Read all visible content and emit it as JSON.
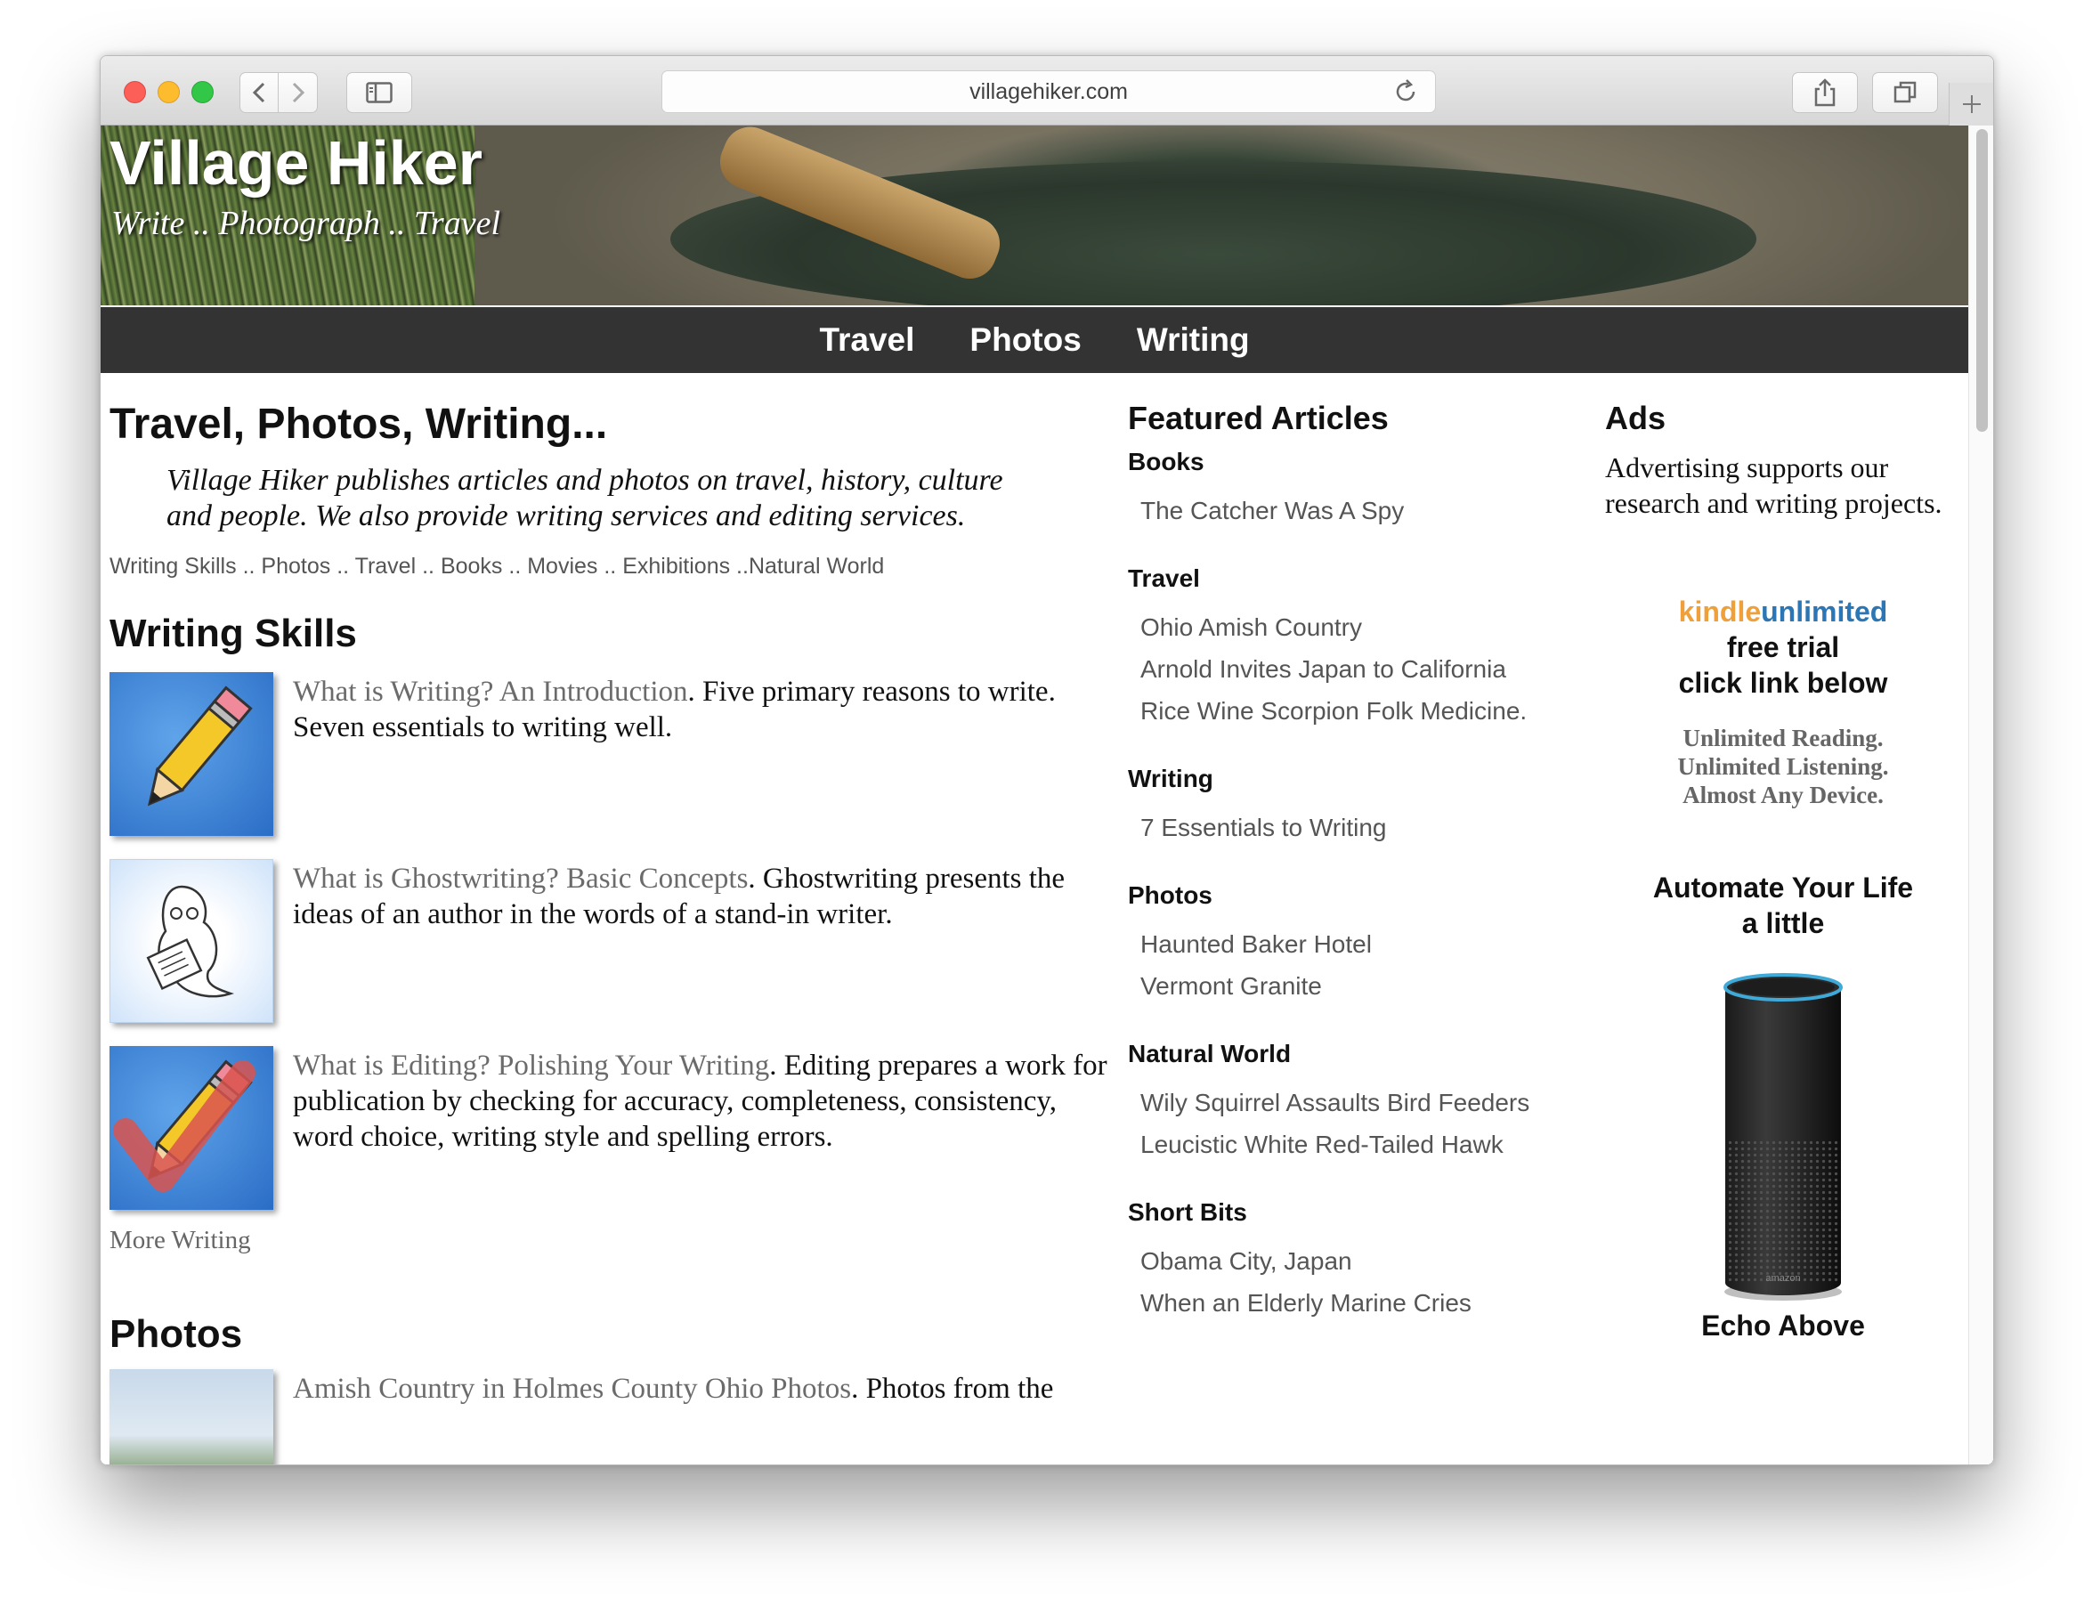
{
  "browser": {
    "url": "villagehiker.com"
  },
  "site": {
    "title": "Village Hiker",
    "tagline": "Write .. Photograph .. Travel"
  },
  "nav": {
    "items": [
      "Travel",
      "Photos",
      "Writing"
    ]
  },
  "main": {
    "heading": "Travel, Photos, Writing...",
    "intro": "Village Hiker publishes articles and photos on travel, history, culture and people. We also provide writing services and editing services.",
    "quicklinks": {
      "writing_skills": "Writing Skills",
      "photos": "Photos",
      "travel": "Travel",
      "books": "Books",
      "movies": "Movies",
      "exhibitions": "Exhibitions",
      "natural_world": "Natural World",
      "sep": " .. ",
      "sep_tight": " .."
    },
    "writing_section": {
      "heading": "Writing Skills",
      "articles": [
        {
          "link": "What is Writing? An Introduction",
          "desc": ". Five primary reasons to write. Seven essentials to writing well.",
          "icon": "pencil-icon"
        },
        {
          "link": "What is Ghostwriting? Basic Concepts",
          "desc": ". Ghostwriting presents the ideas of an author in the words of a stand-in writer.",
          "icon": "ghost-writer-icon"
        },
        {
          "link": "What is Editing? Polishing Your Writing",
          "desc": ". Editing prepares a work for publication by checking for accuracy, completeness, consistency, word choice, writing style and spelling errors.",
          "icon": "pencil-checkmark-icon"
        }
      ],
      "more": "More Writing"
    },
    "photos_section": {
      "heading": "Photos",
      "article": {
        "link": "Amish Country in Holmes County Ohio Photos",
        "desc": ". Photos from the"
      }
    }
  },
  "featured": {
    "heading": "Featured Articles",
    "categories": [
      {
        "name": "Books",
        "items": [
          "The Catcher Was A Spy"
        ]
      },
      {
        "name": "Travel",
        "items": [
          "Ohio Amish Country",
          "Arnold Invites Japan to California",
          "Rice Wine Scorpion Folk Medicine."
        ]
      },
      {
        "name": "Writing",
        "items": [
          "7 Essentials to Writing"
        ]
      },
      {
        "name": "Photos",
        "items": [
          "Haunted Baker Hotel",
          "Vermont Granite"
        ]
      },
      {
        "name": "Natural World",
        "items": [
          "Wily Squirrel Assaults Bird Feeders",
          "Leucistic White Red-Tailed Hawk"
        ]
      },
      {
        "name": "Short Bits",
        "items": [
          "Obama City, Japan",
          "When an Elderly Marine Cries"
        ]
      }
    ]
  },
  "ads": {
    "heading": "Ads",
    "text": "Advertising supports our research and writing projects.",
    "kindle": {
      "brand_1": "kindle",
      "brand_2": "unlimited",
      "line_1": "free trial",
      "line_2": "click link below",
      "sub_1": "Unlimited Reading.",
      "sub_2": "Unlimited Listening.",
      "sub_3": "Almost Any Device."
    },
    "automate": {
      "line_1": "Automate Your Life",
      "line_2": "a little"
    },
    "echo_caption": "Echo Above",
    "echo_logo": "amazon"
  },
  "colors": {
    "navbar": "#333333",
    "link_gray": "#6b6b6b",
    "kindle_orange": "#f0a03a",
    "kindle_blue": "#2c76b5"
  }
}
